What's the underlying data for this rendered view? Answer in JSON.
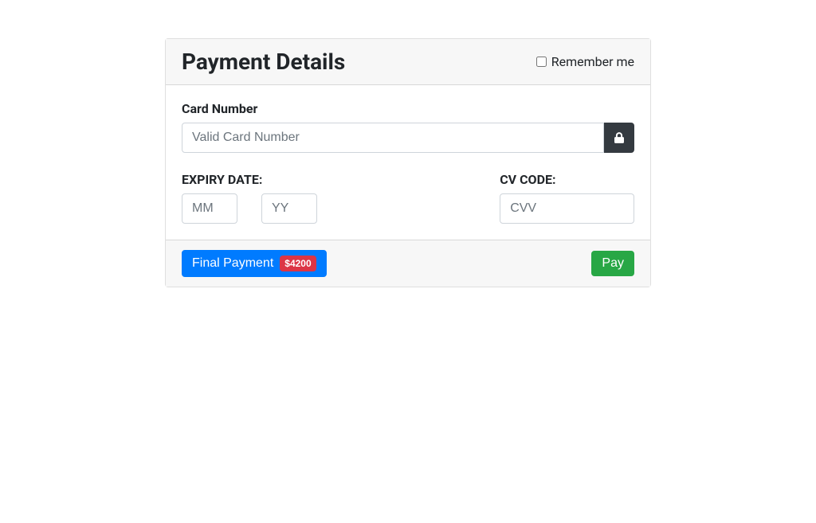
{
  "header": {
    "title": "Payment Details",
    "remember_label": "Remember me"
  },
  "card": {
    "number_label": "Card Number",
    "number_placeholder": "Valid Card Number",
    "expiry_label": "EXPIRY DATE:",
    "mm_placeholder": "MM",
    "yy_placeholder": "YY",
    "cv_label": "CV CODE:",
    "cvv_placeholder": "CVV"
  },
  "footer": {
    "final_label": "Final Payment",
    "amount": "$4200",
    "pay_label": "Pay"
  }
}
